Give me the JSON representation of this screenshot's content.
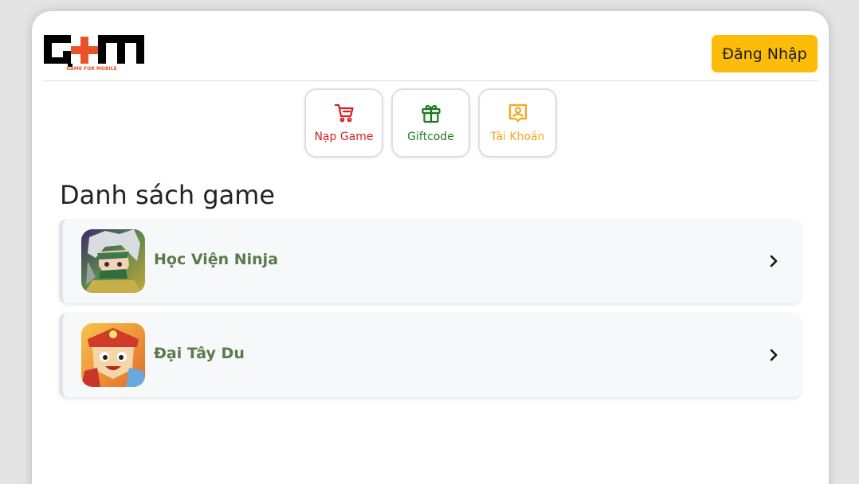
{
  "header": {
    "logo_text": "GAME FOR MOBILE",
    "login_label": "Đăng Nhập"
  },
  "quick_links": [
    {
      "label": "Nạp Game",
      "icon": "cart-icon",
      "color": "#d81f1f"
    },
    {
      "label": "Giftcode",
      "icon": "gift-icon",
      "color": "#1b7a1b"
    },
    {
      "label": "Tài Khoản",
      "icon": "account-icon",
      "color": "#f3a71a"
    }
  ],
  "section": {
    "title": "Danh sách game"
  },
  "games": [
    {
      "name": "Học Viện Ninja",
      "icon": "ninja-avatar"
    },
    {
      "name": "Đại Tây Du",
      "icon": "monkey-king-avatar"
    }
  ],
  "colors": {
    "login_bg": "#fdbc0a",
    "game_name": "#5a7a4a",
    "logo_accent": "#e8532a"
  }
}
